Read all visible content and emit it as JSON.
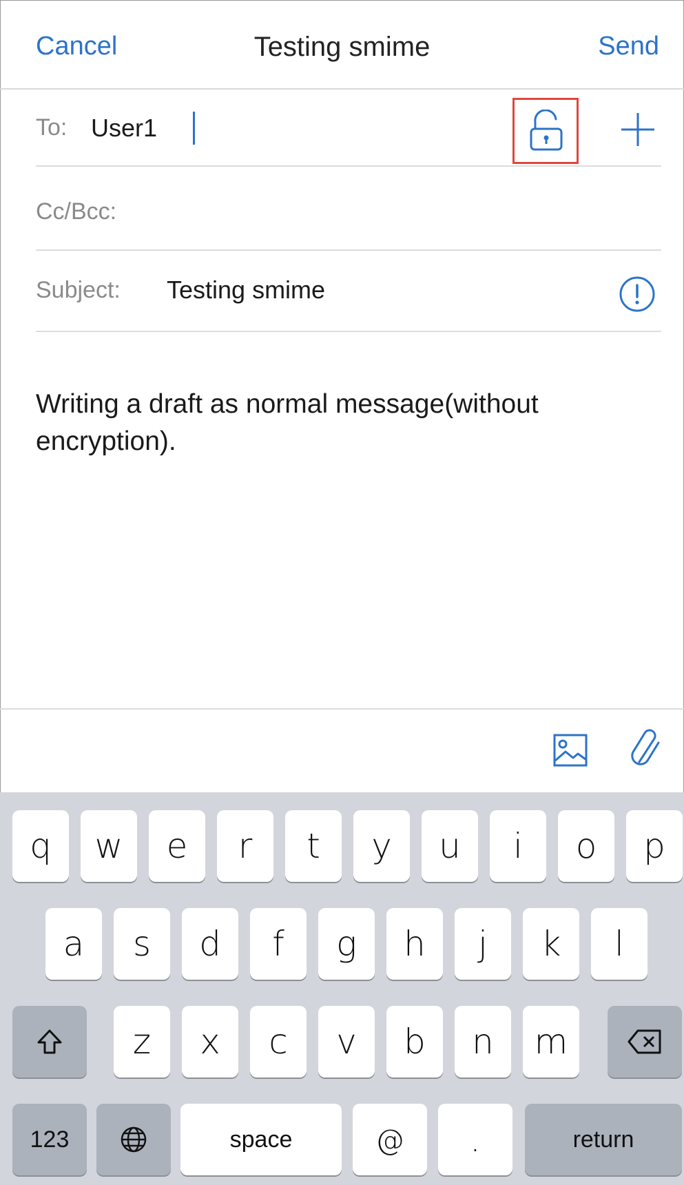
{
  "header": {
    "cancel": "Cancel",
    "title": "Testing smime",
    "send": "Send"
  },
  "fields": {
    "to_label": "To:",
    "to_value": "User1",
    "cc_label": "Cc/Bcc:",
    "subject_label": "Subject:",
    "subject_value": "Testing smime"
  },
  "body": {
    "text": "Writing a draft as normal message(without encryption)."
  },
  "colors": {
    "accent": "#2c73c8",
    "highlight": "#e0463c"
  },
  "icons": [
    "unlock-icon",
    "plus-icon",
    "info-icon",
    "image-icon",
    "paperclip-icon"
  ],
  "keyboard": {
    "row1": [
      "q",
      "w",
      "e",
      "r",
      "t",
      "y",
      "u",
      "i",
      "o",
      "p"
    ],
    "row2": [
      "a",
      "s",
      "d",
      "f",
      "g",
      "h",
      "j",
      "k",
      "l"
    ],
    "row3": [
      "z",
      "x",
      "c",
      "v",
      "b",
      "n",
      "m"
    ],
    "numbers": "123",
    "space": "space",
    "at": "@",
    "dot": ".",
    "return": "return"
  }
}
